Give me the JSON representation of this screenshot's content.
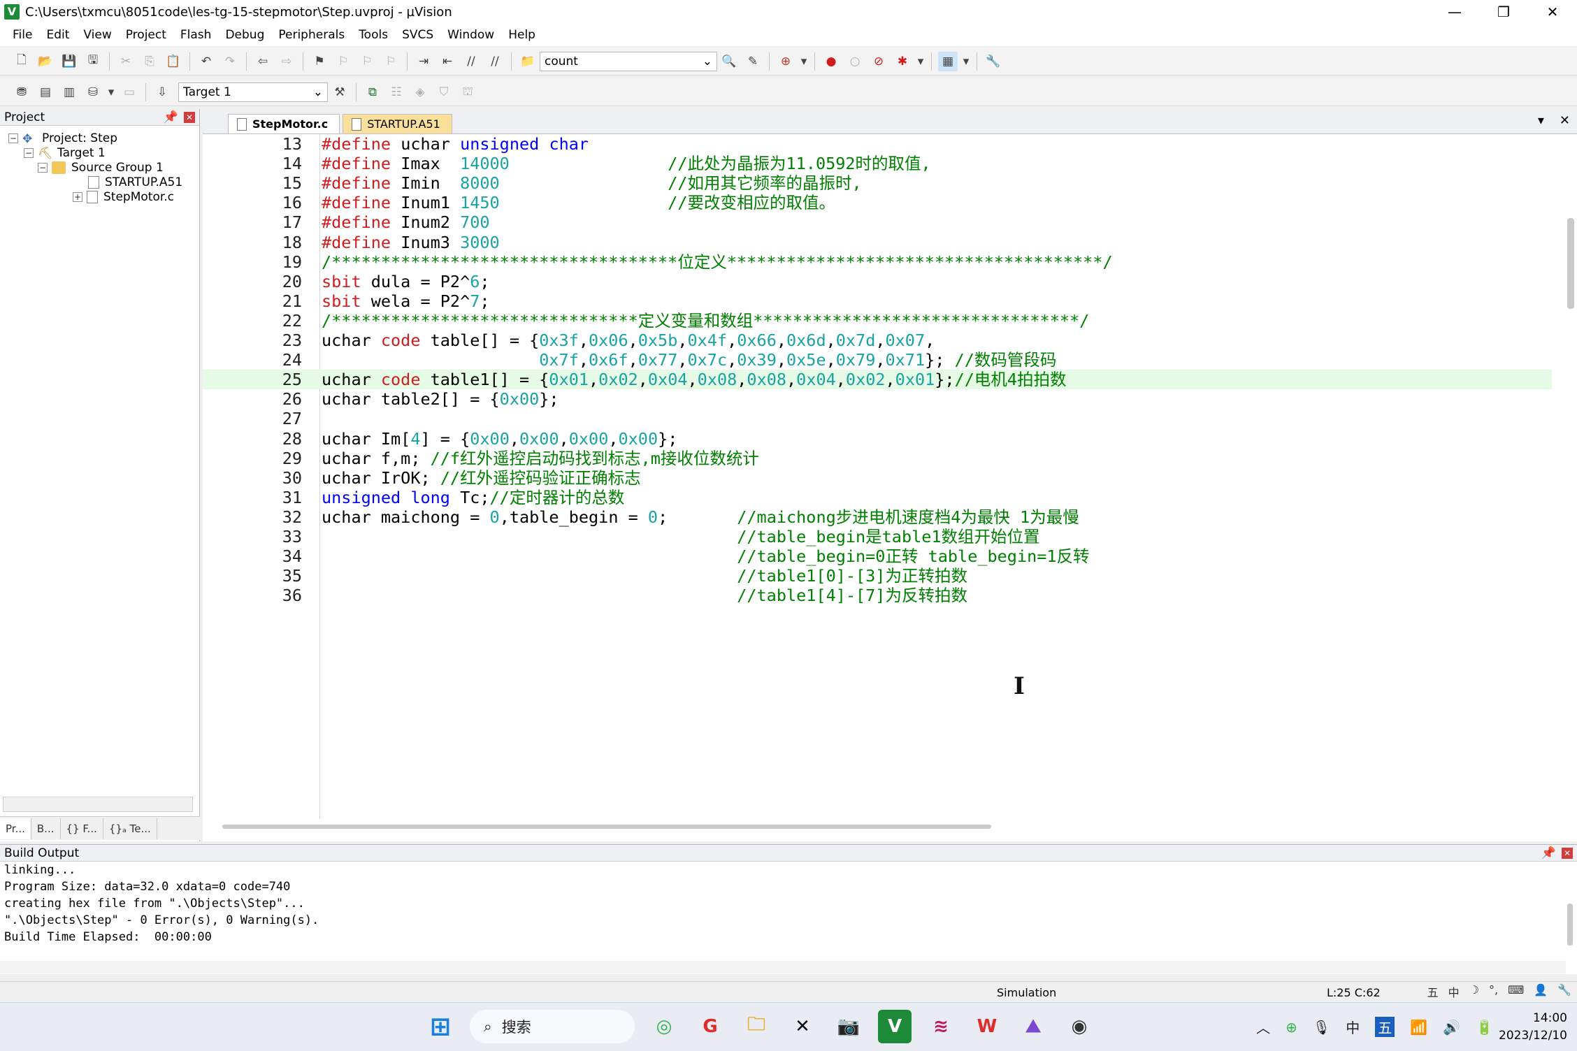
{
  "window": {
    "title": "C:\\Users\\txmcu\\8051code\\les-tg-15-stepmotor\\Step.uvproj - µVision",
    "minimize": "—",
    "restore": "❐",
    "close": "✕"
  },
  "menu": [
    "File",
    "Edit",
    "View",
    "Project",
    "Flash",
    "Debug",
    "Peripherals",
    "Tools",
    "SVCS",
    "Window",
    "Help"
  ],
  "toolbar": {
    "find_value": "count",
    "target_value": "Target 1"
  },
  "project_pane": {
    "title": "Project",
    "tree": [
      {
        "label": "Project: Step",
        "expander": "−"
      },
      {
        "label": "Target 1",
        "expander": "−"
      },
      {
        "label": "Source Group 1",
        "expander": "−"
      },
      {
        "label": "STARTUP.A51",
        "expander": ""
      },
      {
        "label": "StepMotor.c",
        "expander": "+"
      }
    ],
    "tabs": [
      "Pr...",
      "B...",
      "{} F...",
      "{}ₐ Te..."
    ]
  },
  "editor": {
    "tabs": [
      {
        "label": "StepMotor.c",
        "active": true
      },
      {
        "label": "STARTUP.A51",
        "active": false
      }
    ],
    "lines": [
      {
        "n": "13",
        "text": "#define uchar unsigned char"
      },
      {
        "n": "14",
        "text": "#define Imax  14000                //此处为晶振为11.0592时的取值,"
      },
      {
        "n": "15",
        "text": "#define Imin  8000                 //如用其它频率的晶振时,"
      },
      {
        "n": "16",
        "text": "#define Inum1 1450                 //要改变相应的取值。"
      },
      {
        "n": "17",
        "text": "#define Inum2 700"
      },
      {
        "n": "18",
        "text": "#define Inum3 3000"
      },
      {
        "n": "19",
        "text": "/***********************************位定义**************************************/"
      },
      {
        "n": "20",
        "text": "sbit dula = P2^6;"
      },
      {
        "n": "21",
        "text": "sbit wela = P2^7;"
      },
      {
        "n": "22",
        "text": "/*******************************定义变量和数组*********************************/"
      },
      {
        "n": "23",
        "text": "uchar code table[] = {0x3f,0x06,0x5b,0x4f,0x66,0x6d,0x7d,0x07,"
      },
      {
        "n": "24",
        "text": "                      0x7f,0x6f,0x77,0x7c,0x39,0x5e,0x79,0x71}; //数码管段码"
      },
      {
        "n": "25",
        "text": "uchar code table1[] = {0x01,0x02,0x04,0x08,0x08,0x04,0x02,0x01};//电机4拍拍数"
      },
      {
        "n": "26",
        "text": "uchar table2[] = {0x00};"
      },
      {
        "n": "27",
        "text": ""
      },
      {
        "n": "28",
        "text": "uchar Im[4] = {0x00,0x00,0x00,0x00};"
      },
      {
        "n": "29",
        "text": "uchar f,m; //f红外遥控启动码找到标志,m接收位数统计"
      },
      {
        "n": "30",
        "text": "uchar IrOK; //红外遥控码验证正确标志"
      },
      {
        "n": "31",
        "text": "unsigned long Tc;//定时器计的总数"
      },
      {
        "n": "32",
        "text": "uchar maichong = 0,table_begin = 0;       //maichong步进电机速度档4为最快 1为最慢"
      },
      {
        "n": "33",
        "text": "                                          //table_begin是table1数组开始位置"
      },
      {
        "n": "34",
        "text": "                                          //table_begin=0正转 table_begin=1反转"
      },
      {
        "n": "35",
        "text": "                                          //table1[0]-[3]为正转拍数"
      },
      {
        "n": "36",
        "text": "                                          //table1[4]-[7]为反转拍数"
      }
    ]
  },
  "build": {
    "title": "Build Output",
    "lines": [
      "linking...",
      "Program Size: data=32.0 xdata=0 code=740",
      "creating hex file from \".\\Objects\\Step\"...",
      "\".\\Objects\\Step\" - 0 Error(s), 0 Warning(s).",
      "Build Time Elapsed:  00:00:00"
    ]
  },
  "status": {
    "mode": "Simulation",
    "position": "L:25 C:62"
  },
  "taskbar": {
    "search": "搜索",
    "time": "14:00",
    "date": "2023/12/10",
    "ime": "中"
  },
  "colors": {
    "keyword": "#0000ff",
    "number": "#19a3a3",
    "comment": "#008000",
    "preprocessor": "#d01c1c",
    "current_line": "#e6fbe6"
  }
}
